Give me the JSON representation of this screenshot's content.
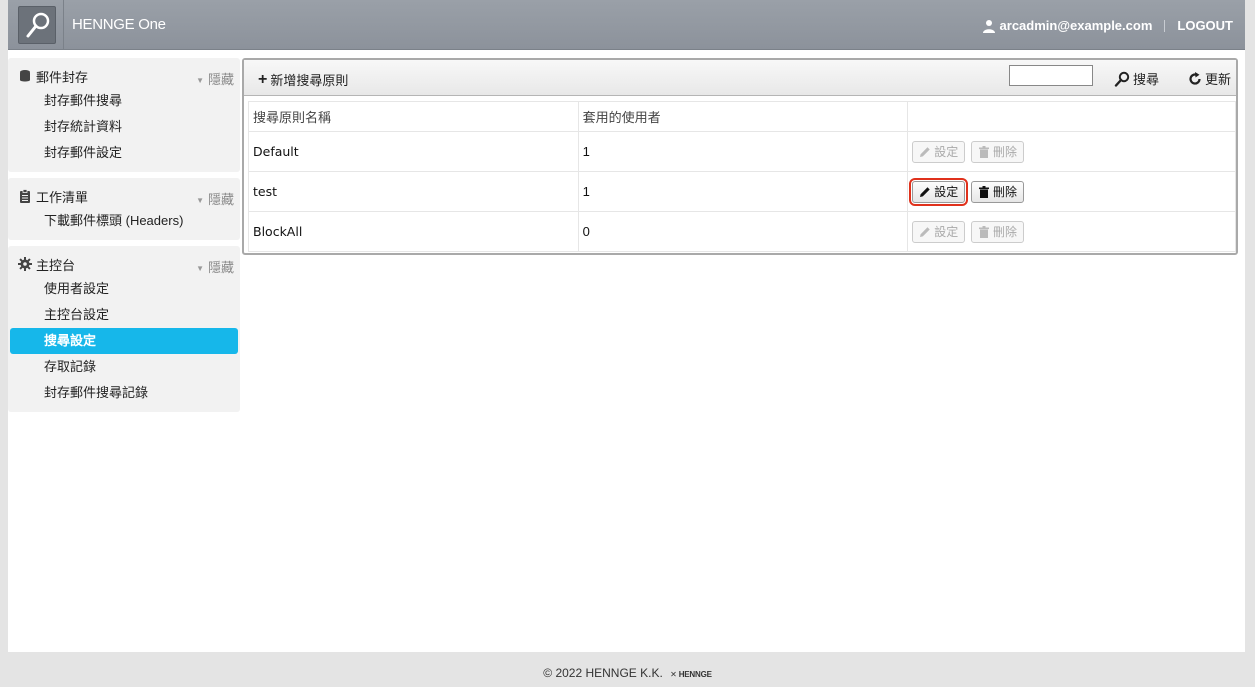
{
  "header": {
    "brand": "HENNGE One",
    "user": "arcadmin@example.com",
    "logout": "LOGOUT"
  },
  "sidebar": {
    "groups": [
      {
        "title": "郵件封存",
        "icon": "database-icon",
        "hide_label": "隱藏",
        "items": [
          {
            "label": "封存郵件搜尋"
          },
          {
            "label": "封存統計資料"
          },
          {
            "label": "封存郵件設定"
          }
        ]
      },
      {
        "title": "工作清單",
        "icon": "clipboard-icon",
        "hide_label": "隱藏",
        "items": [
          {
            "label": "下載郵件標頭 (Headers)"
          }
        ]
      },
      {
        "title": "主控台",
        "icon": "gear-icon",
        "hide_label": "隱藏",
        "items": [
          {
            "label": "使用者設定"
          },
          {
            "label": "主控台設定"
          },
          {
            "label": "搜尋設定",
            "active": true
          },
          {
            "label": "存取記錄"
          },
          {
            "label": "封存郵件搜尋記錄"
          }
        ]
      }
    ]
  },
  "toolbar": {
    "add_label": "新增搜尋原則",
    "search_value": "",
    "search_label": "搜尋",
    "refresh_label": "更新"
  },
  "table": {
    "columns": [
      "搜尋原則名稱",
      "套用的使用者",
      ""
    ],
    "rows": [
      {
        "name": "Default",
        "users": "1",
        "edit": "設定",
        "delete": "刪除",
        "enabled": false
      },
      {
        "name": "test",
        "users": "1",
        "edit": "設定",
        "delete": "刪除",
        "enabled": true
      },
      {
        "name": "BlockAll",
        "users": "0",
        "edit": "設定",
        "delete": "刪除",
        "enabled": false
      }
    ]
  },
  "footer": {
    "copyright": "© 2022 HENNGE K.K.",
    "logo_text": "HENNGE"
  },
  "colors": {
    "header": "#8f959d",
    "active_item": "#16b7ea",
    "focus_outline": "#e0311c"
  }
}
